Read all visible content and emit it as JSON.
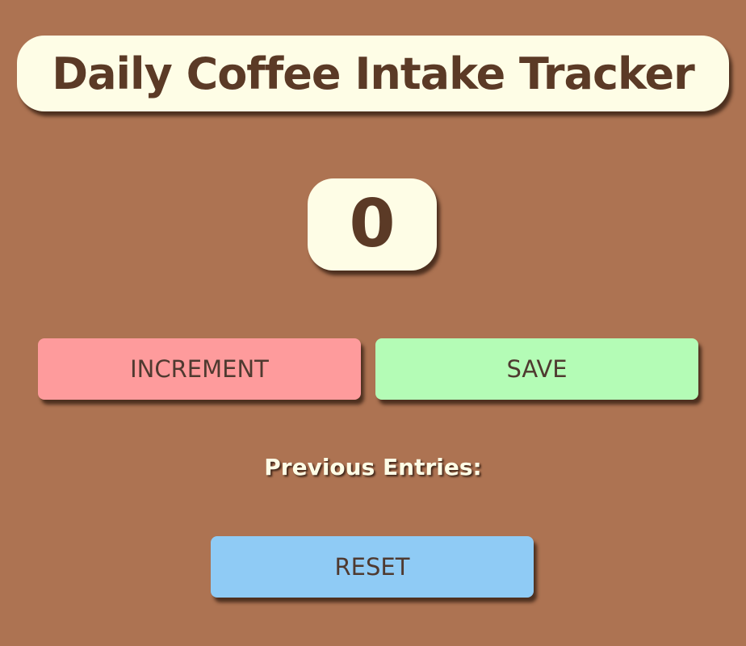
{
  "header": {
    "title": "Daily Coffee Intake Tracker"
  },
  "counter": {
    "value": "0"
  },
  "actions": {
    "increment_label": "INCREMENT",
    "save_label": "SAVE",
    "reset_label": "RESET"
  },
  "entries": {
    "label": "Previous Entries:",
    "items": []
  },
  "colors": {
    "background": "#ad7352",
    "panel": "#fefde6",
    "text_dark": "#5b3a26",
    "increment": "#fe9b9c",
    "save": "#b4fcb6",
    "reset": "#8fcbf5"
  }
}
